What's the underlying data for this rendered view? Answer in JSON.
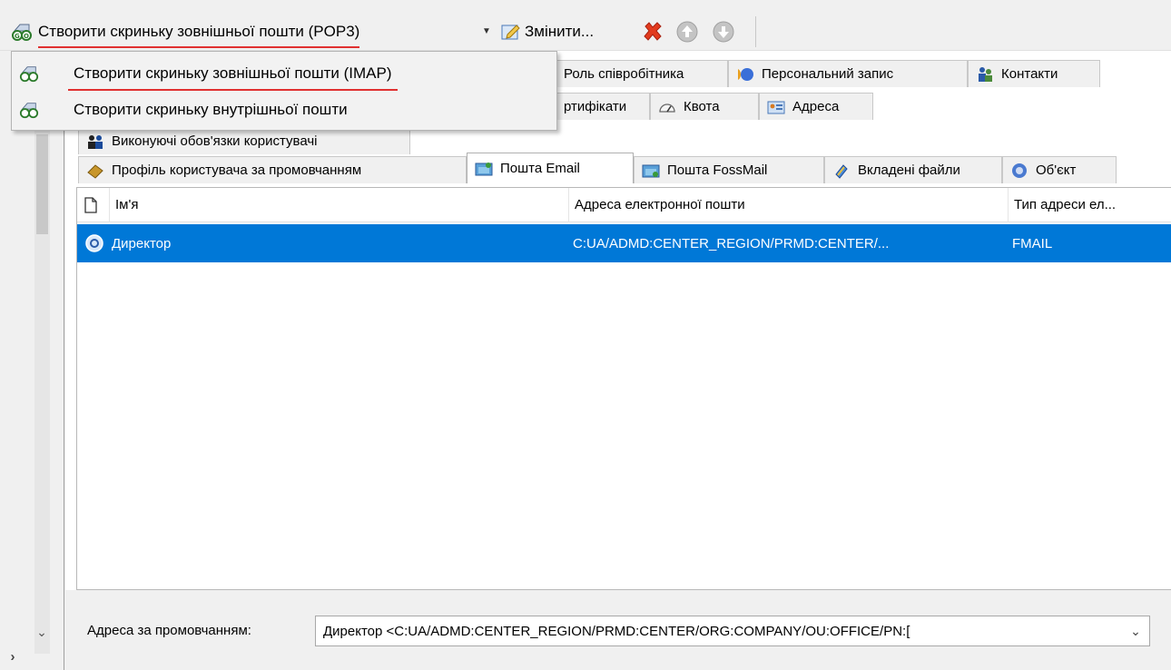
{
  "toolbar": {
    "create_label": "Створити скриньку зовнішньої пошти (POP3)",
    "edit_label": "Змінити..."
  },
  "menu": {
    "items": [
      {
        "label": "Створити скриньку зовнішньої пошти (IMAP)"
      },
      {
        "label": "Створити скриньку внутрішньої пошти"
      }
    ]
  },
  "tabs": {
    "row1": [
      "Роль співробітника",
      "Персональний запис",
      "Контакти"
    ],
    "row2": [
      "ртифікати",
      "Квота",
      "Адреса"
    ],
    "row3": [
      "Виконуючі обов'язки користувачі"
    ],
    "row4": [
      "Профіль користувача за промовчанням",
      "Пошта Email",
      "Пошта FossMail",
      "Вкладені файли",
      "Об'єкт"
    ]
  },
  "list": {
    "columns": [
      "Ім'я",
      "Адреса електронної пошти",
      "Тип адреси ел..."
    ],
    "rows": [
      {
        "name": "Директор",
        "address": "C:UA/ADMD:CENTER_REGION/PRMD:CENTER/...",
        "type": "FMAIL"
      }
    ]
  },
  "default_address": {
    "label": "Адреса за промовчанням:",
    "value": "Директор <C:UA/ADMD:CENTER_REGION/PRMD:CENTER/ORG:COMPANY/OU:OFFICE/PN:["
  },
  "colors": {
    "selection": "#0078d7",
    "highlight_underline": "#e03030"
  }
}
